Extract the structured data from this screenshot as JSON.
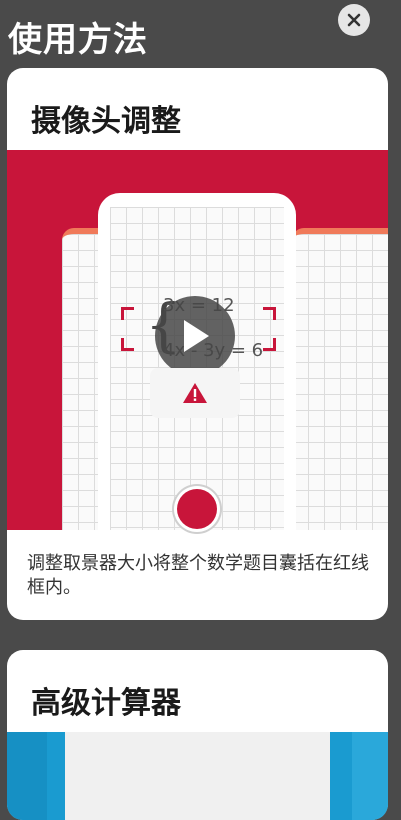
{
  "page": {
    "title": "使用方法"
  },
  "close_button": {
    "label": "✕"
  },
  "cards": [
    {
      "title": "摄像头调整",
      "description": "调整取景器大小将整个数学题目囊括在红线框内。",
      "equation_line1": "3x = 12",
      "equation_line2": "4x - 3y = 6",
      "colors": {
        "accent": "#c8153a"
      }
    },
    {
      "title": "高级计算器",
      "colors": {
        "accent": "#1a9bd0"
      }
    }
  ]
}
